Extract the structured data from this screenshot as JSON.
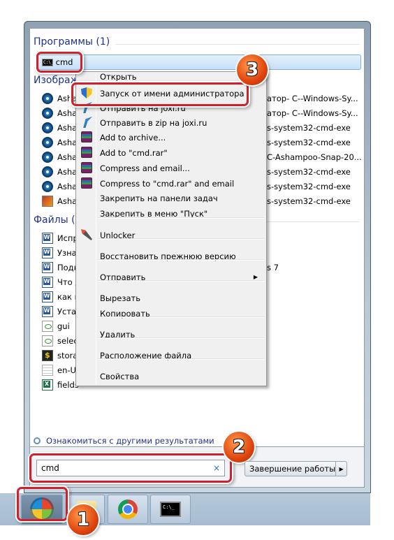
{
  "programs": {
    "header": "Программы (1)",
    "item": "cmd",
    "icon": "cmd-icon"
  },
  "images": {
    "header": "Изображения",
    "items": [
      {
        "left": "Asha",
        "right": "атор- C--Windows-Sy...",
        "icon": "disc-image-icon"
      },
      {
        "left": "Asha",
        "right": "атор- C--Windows-Sy...",
        "icon": "disc-image-icon"
      },
      {
        "left": "Asha",
        "right": "s-system32-cmd-exe",
        "icon": "disc-image-icon"
      },
      {
        "left": "Asha",
        "right": "s-system32-cmd-exe",
        "icon": "disc-image-icon"
      },
      {
        "left": "Asha",
        "right": "C-Ashampoo-Snap-20...",
        "icon": "disc-image-icon"
      },
      {
        "left": "Asha",
        "right": "s-system32-cmd-exe",
        "icon": "disc-image-icon"
      },
      {
        "left": "Asha",
        "right": "s-system32-cmd-exe",
        "icon": "disc-image-icon"
      },
      {
        "left": "Asha",
        "right": "s-system32-cmd-exe",
        "icon": "picture-icon"
      }
    ]
  },
  "files": {
    "header": "Файлы (",
    "items": [
      {
        "left": "Испр",
        "right": "",
        "icon": "word"
      },
      {
        "left": "Узна",
        "right": "",
        "icon": "word"
      },
      {
        "left": "Подк",
        "right": "s 7",
        "icon": "word"
      },
      {
        "left": "Что д",
        "right": "",
        "icon": "word"
      },
      {
        "left": "как и",
        "right": "",
        "icon": "word"
      },
      {
        "left": "Устан",
        "right": "",
        "icon": "word"
      },
      {
        "left": "gui",
        "right": "",
        "icon": "htm"
      },
      {
        "left": "selec",
        "right": "",
        "icon": "htm"
      },
      {
        "left": "stora",
        "right": "",
        "icon": "cfg"
      },
      {
        "left": "en-U",
        "right": "",
        "icon": "txt"
      },
      {
        "left": "fields",
        "right": "",
        "icon": "xls"
      }
    ]
  },
  "context_menu": {
    "hidden_item": "Открыть",
    "items": [
      {
        "label": "Запуск от имени администратора",
        "icon": "shield"
      },
      {
        "label": "Отправить на joxi.ru",
        "icon": "joxi"
      },
      {
        "label": "Отправить в zip на joxi.ru",
        "icon": "joxi"
      },
      {
        "label": "Add to archive...",
        "icon": "rar"
      },
      {
        "label": "Add to \"cmd.rar\"",
        "icon": "rar"
      },
      {
        "label": "Compress and email...",
        "icon": "rar"
      },
      {
        "label": "Compress to \"cmd.rar\" and email",
        "icon": "rar"
      },
      {
        "label": "Закрепить на панели задач",
        "icon": ""
      },
      {
        "label": "Закрепить в меню \"Пуск\"",
        "icon": ""
      },
      {
        "label": "Unlocker",
        "icon": "wand"
      },
      {
        "label": "Восстановить прежнюю версию",
        "icon": ""
      },
      {
        "label": "Отправить",
        "icon": "",
        "submenu": true
      },
      {
        "label": "Вырезать",
        "icon": ""
      },
      {
        "label": "Копировать",
        "icon": ""
      },
      {
        "label": "Удалить",
        "icon": ""
      },
      {
        "label": "Расположение файла",
        "icon": ""
      },
      {
        "label": "Свойства",
        "icon": ""
      }
    ]
  },
  "more_results": "Ознакомиться с другими результатами",
  "search": {
    "value": "cmd",
    "clear": "×"
  },
  "shutdown": {
    "label": "Завершение работы",
    "arrow": "▶"
  },
  "taskbar": {
    "cmd_text": "C:\\_"
  },
  "badges": [
    "1",
    "2",
    "3"
  ],
  "colors": {
    "highlight": "#d0202b",
    "badge": "#e0440e",
    "link": "#1e3287"
  }
}
